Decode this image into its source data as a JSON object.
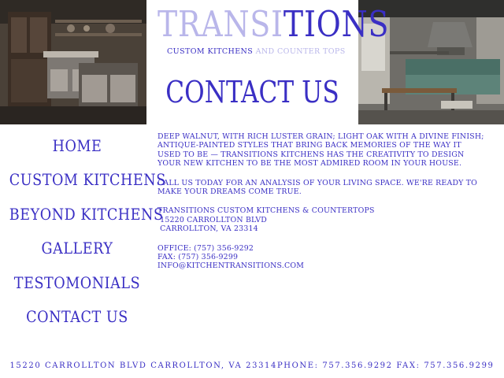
{
  "brand": {
    "light_part": "TRANSI",
    "dark_part": "TIONS",
    "tagline_dark": "CUSTOM KITCHENS",
    "tagline_light": " AND COUNTER TOPS"
  },
  "page_title": "CONTACT US",
  "nav": {
    "items": [
      {
        "label": "HOME"
      },
      {
        "label": "CUSTOM KITCHENS"
      },
      {
        "label": "BEYOND KITCHENS"
      },
      {
        "label": "GALLERY"
      },
      {
        "label": "TESTOMONIALS"
      },
      {
        "label": "CONTACT US"
      }
    ]
  },
  "content": {
    "intro": "Deep walnut, with rich luster grain; light oak with a divine finish; antique-painted styles that bring back memories of the way it used to be — Transitions Kitchens has the creativity to design your new kitchen to be the most admired room in your house.",
    "call": "Call us today for an analysis of your living space. We're ready to make your dreams come true.",
    "company": "Transitions Custom Kitchens & Countertops",
    "street": " 15220 Carrollton Blvd",
    "city": " Carrollton, VA 23314",
    "office": "Office: (757) 356-9292",
    "fax": "Fax: (757) 356-9299",
    "email": "info@kitchentransitions.com"
  },
  "footer": {
    "text": "15220 CARROLLTON BLVD CARROLLTON, VA 23314PHONE: 757.356.9292 FAX: 757.356.9299"
  },
  "colors": {
    "accent": "#3a2fc4",
    "accent_light": "#b9b6ea",
    "background": "#ffffff"
  }
}
